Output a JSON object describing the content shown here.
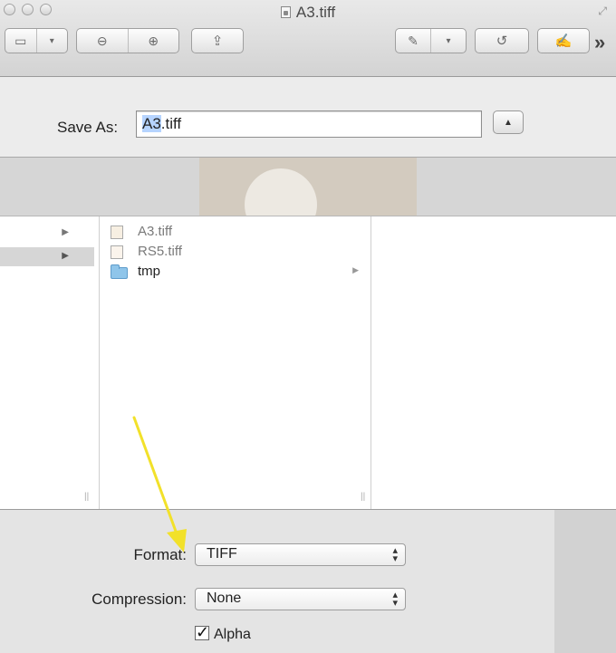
{
  "window": {
    "title": "A3.tiff"
  },
  "toolbar": {
    "sidebar_icon": "sidebar-icon",
    "zoom_out_icon": "zoom-out-icon",
    "zoom_in_icon": "zoom-in-icon",
    "share_icon": "share-icon",
    "markup_icon": "pen-icon",
    "rotate_icon": "rotate-icon",
    "edit_icon": "edit-icon",
    "overflow": "»"
  },
  "save": {
    "label": "Save As:",
    "filename_selected": "A3",
    "filename_rest": ".tiff"
  },
  "browser": {
    "files": [
      {
        "name": "A3.tiff",
        "icon": "tiff-image-icon"
      },
      {
        "name": "RS5.tiff",
        "icon": "tiff-image-icon"
      },
      {
        "name": "tmp",
        "icon": "folder-icon"
      }
    ]
  },
  "options": {
    "format_label": "Format:",
    "format_value": "TIFF",
    "compression_label": "Compression:",
    "compression_value": "None",
    "alpha_label": "Alpha",
    "alpha_checked": true
  },
  "colors": {
    "selection": "#b6d4ff",
    "annotation_arrow": "#f2e12a",
    "folder": "#8fc5ea"
  }
}
